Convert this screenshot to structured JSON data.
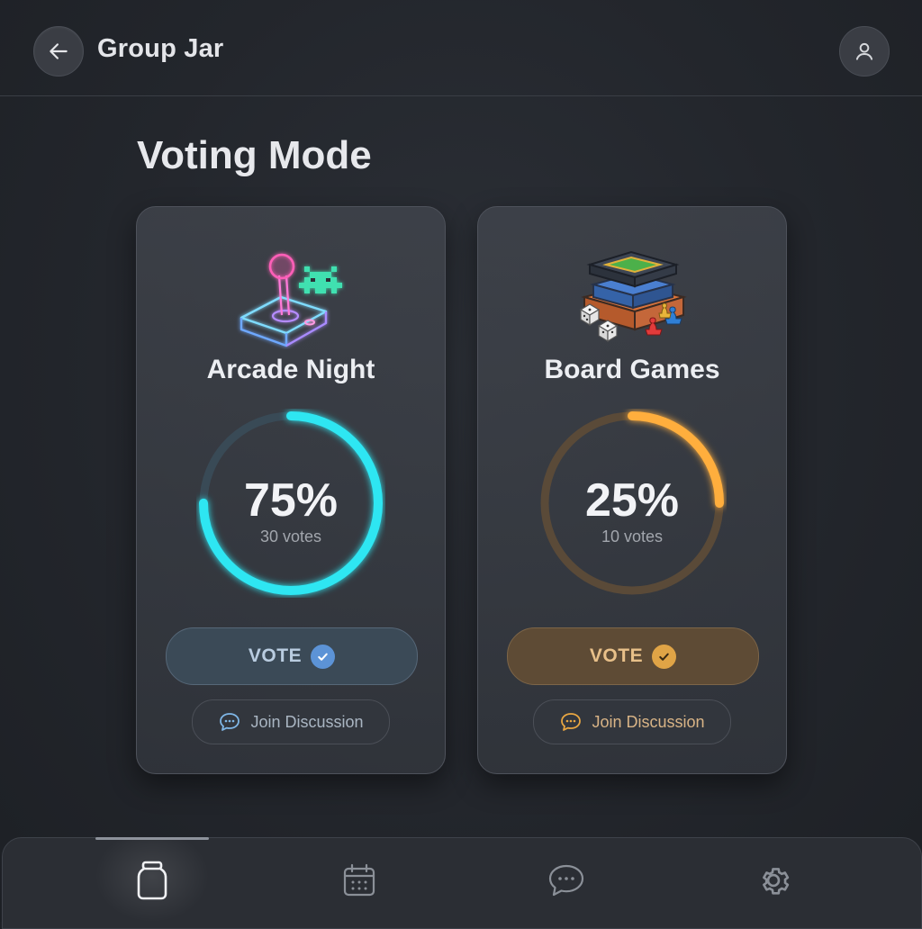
{
  "header": {
    "back_icon": "arrow-left-icon",
    "title": "Group Jar",
    "profile_icon": "user-icon"
  },
  "page": {
    "title": "Voting Mode"
  },
  "options": [
    {
      "title": "Arcade Night",
      "percent": 75,
      "percent_label": "75%",
      "votes_label": "30 votes",
      "vote_label": "VOTE",
      "discuss_label": "Join Discussion",
      "accent": "#2ee6f2",
      "illustration": "arcade-joystick-icon"
    },
    {
      "title": "Board Games",
      "percent": 25,
      "percent_label": "25%",
      "votes_label": "10 votes",
      "vote_label": "VOTE",
      "discuss_label": "Join Discussion",
      "accent": "#ffae3d",
      "illustration": "board-games-icon"
    }
  ],
  "nav": {
    "items": [
      {
        "name": "jar",
        "icon": "jar-icon",
        "active": true
      },
      {
        "name": "calendar",
        "icon": "calendar-icon",
        "active": false
      },
      {
        "name": "chat",
        "icon": "chat-icon",
        "active": false
      },
      {
        "name": "settings",
        "icon": "gear-icon",
        "active": false
      }
    ]
  },
  "colors": {
    "background": "#23262c",
    "card": "#3b3f46",
    "cyan": "#2ee6f2",
    "orange": "#ffae3d"
  }
}
